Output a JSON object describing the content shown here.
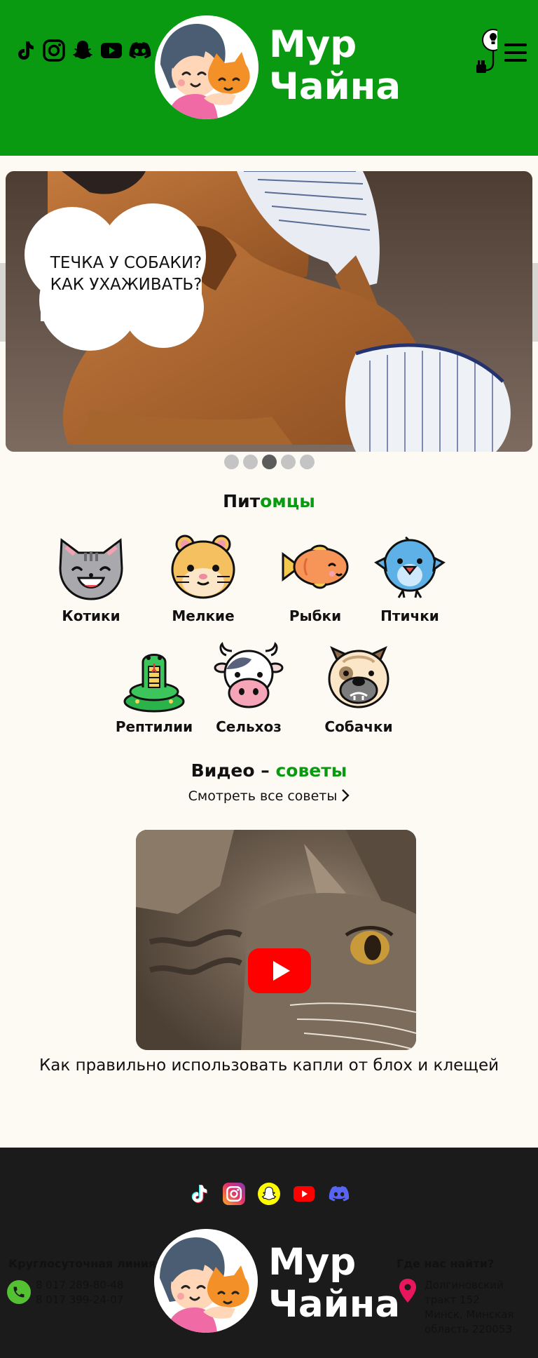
{
  "header": {
    "brand_line1": "Мур",
    "brand_line2": "Чайна",
    "social_icons": [
      "tiktok-icon",
      "instagram-icon",
      "snapchat-icon",
      "youtube-icon",
      "discord-icon"
    ],
    "bg_color": "#0a9a12"
  },
  "slider": {
    "caption_line1": "ТЕЧКА У СОБАКИ?",
    "caption_line2": "КАК УХАЖИВАТЬ?",
    "dots_count": 5,
    "active_dot": 3
  },
  "pets": {
    "title_part1": "Пит",
    "title_part2": "омцы",
    "items": [
      {
        "label": "Котики",
        "icon": "cat-icon"
      },
      {
        "label": "Мелкие",
        "icon": "hamster-icon"
      },
      {
        "label": "Рыбки",
        "icon": "fish-icon"
      },
      {
        "label": "Птички",
        "icon": "bird-icon"
      },
      {
        "label": "Рептилии",
        "icon": "snake-icon"
      },
      {
        "label": "Сельхоз",
        "icon": "cow-icon"
      },
      {
        "label": "Собачки",
        "icon": "dog-icon"
      }
    ]
  },
  "video": {
    "title_part1": "Видео – ",
    "title_part2": "советы",
    "all_link": "Смотреть все советы",
    "caption": "Как правильно использовать капли от блох и клещей"
  },
  "footer": {
    "brand_line1": "Мур",
    "brand_line2": "Чайна",
    "hotline_title": "Круглосуточная линия",
    "phone1": "8 017 289-80-48",
    "phone2": "8 017 399-24-07",
    "where_title": "Где нас найти?",
    "address_line1": "Долгиновский",
    "address_line2": "тракт 152",
    "address_line3": "Минск, Минская",
    "address_line4": "область 220053"
  },
  "colors": {
    "accent": "#0a9a12",
    "footer_bg": "#1b1b1b",
    "youtube_red": "#ff0000"
  }
}
